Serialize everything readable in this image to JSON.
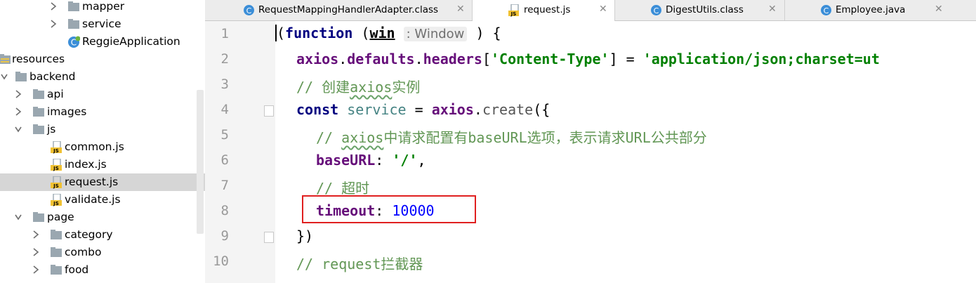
{
  "tree": {
    "items": [
      {
        "label": "mapper",
        "type": "folder",
        "expanded": false
      },
      {
        "label": "service",
        "type": "folder",
        "expanded": false
      },
      {
        "label": "ReggieApplication",
        "type": "class"
      },
      {
        "label": "resources",
        "type": "resources-folder",
        "expanded": true
      },
      {
        "label": "backend",
        "type": "folder",
        "expanded": true
      },
      {
        "label": "api",
        "type": "folder",
        "expanded": false
      },
      {
        "label": "images",
        "type": "folder",
        "expanded": false
      },
      {
        "label": "js",
        "type": "folder",
        "expanded": true
      },
      {
        "label": "common.js",
        "type": "js-file"
      },
      {
        "label": "index.js",
        "type": "js-file"
      },
      {
        "label": "request.js",
        "type": "js-file",
        "selected": true
      },
      {
        "label": "validate.js",
        "type": "js-file"
      },
      {
        "label": "page",
        "type": "folder",
        "expanded": true
      },
      {
        "label": "category",
        "type": "folder",
        "expanded": false
      },
      {
        "label": "combo",
        "type": "folder",
        "expanded": false
      },
      {
        "label": "food",
        "type": "folder",
        "expanded": false
      }
    ]
  },
  "tabs": [
    {
      "label": "RequestMappingHandlerAdapter.class",
      "icon": "class-icon",
      "active": false
    },
    {
      "label": "request.js",
      "icon": "js-file-icon",
      "active": true
    },
    {
      "label": "DigestUtils.class",
      "icon": "class-icon",
      "active": false
    },
    {
      "label": "Employee.java",
      "icon": "java-class-icon",
      "active": false
    }
  ],
  "close_glyph": "✕",
  "editor": {
    "line_numbers": [
      "1",
      "2",
      "3",
      "4",
      "5",
      "6",
      "7",
      "8",
      "9",
      "10"
    ],
    "line1": {
      "paren": "(",
      "kw": "function",
      "open": " (",
      "param": "win",
      "hint": ": Window",
      "close": " ) {"
    },
    "line2": {
      "obj": "axios",
      "dot1": ".",
      "p1": "defaults",
      "dot2": ".",
      "p2": "headers",
      "b1": "[",
      "key": "'Content-Type'",
      "b2": "] = ",
      "val": "'application/json;charset=ut"
    },
    "line3": {
      "prefix": "// 创建",
      "word": "axios",
      "suffix": "实例"
    },
    "line4": {
      "kw": "const",
      "sp": " ",
      "var": "service",
      "eq": " = ",
      "obj": "axios",
      "dot": ".",
      "fn": "create",
      "rest": "({"
    },
    "line5": {
      "prefix": "// ",
      "word": "axios",
      "suffix": "中请求配置有baseURL选项，表示请求URL公共部分"
    },
    "line6": {
      "key": "baseURL",
      "colon": ": ",
      "val": "'/'",
      "comma": ","
    },
    "line7": {
      "text": "// 超时"
    },
    "line8": {
      "key": "timeout",
      "colon": ": ",
      "val": "10000"
    },
    "line9": {
      "text": "})"
    },
    "line10": {
      "text": "// request拦截器"
    }
  },
  "colors": {
    "keyword": "#000080",
    "property": "#660e7a",
    "string": "#008000",
    "number": "#0000ff",
    "comment": "#629755",
    "highlight_box": "#e02020",
    "selection": "#d6d6d6"
  }
}
